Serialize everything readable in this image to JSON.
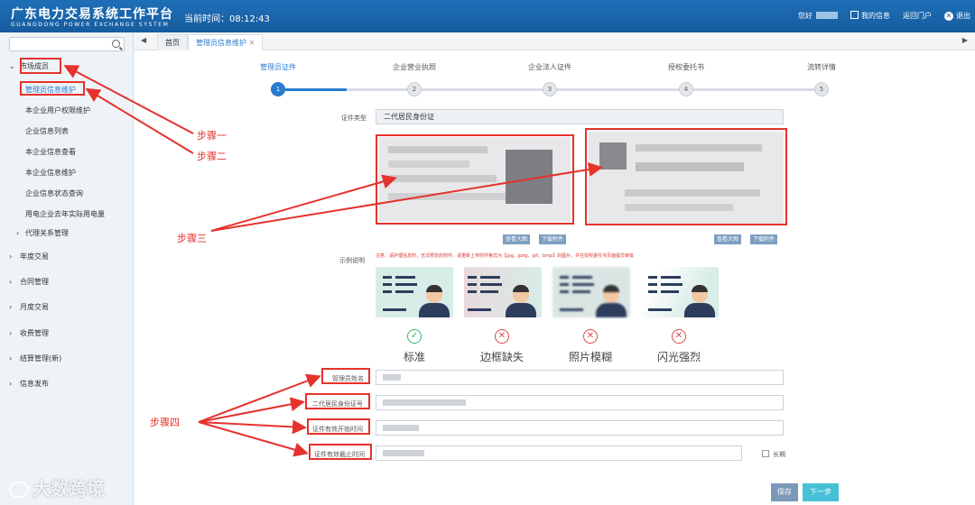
{
  "header": {
    "title": "广东电力交易系统工作平台",
    "subtitle": "GUANGDONG POWER EXCHANGE SYSTEM",
    "time_label": "当前时间：08:12:43",
    "greeting": "您好",
    "my_info": "我的信息",
    "back_portal": "返回门户",
    "logout": "退出"
  },
  "sidebar": {
    "search_placeholder": "",
    "sections": [
      {
        "label": "市场成员",
        "expanded": true
      },
      {
        "label": "年度交易"
      },
      {
        "label": "合同管理"
      },
      {
        "label": "月度交易"
      },
      {
        "label": "收费管理"
      },
      {
        "label": "结算管理(新)"
      },
      {
        "label": "信息发布"
      }
    ],
    "sub_items": [
      "管理员信息维护",
      "本企业用户权限维护",
      "企业信息列表",
      "本企业信息查看",
      "本企业信息维护",
      "企业信息状态查询",
      "用电企业去年实际用电量"
    ],
    "sub_section": "代理关系管理"
  },
  "tabs": {
    "home": "首页",
    "current": "管理员信息维护",
    "close": "✕"
  },
  "steps": [
    {
      "label": "管理员证件",
      "num": "1"
    },
    {
      "label": "企业营业执照",
      "num": "2"
    },
    {
      "label": "企业法人证件",
      "num": "3"
    },
    {
      "label": "授权委托书",
      "num": "4"
    },
    {
      "label": "流转详情",
      "num": "5"
    }
  ],
  "form": {
    "cert_type_label": "证件类型",
    "cert_type_value": "二代居民身份证",
    "view_large": "查看大图",
    "download": "下载附件",
    "example_label": "示例说明",
    "note": "注意：请护理信息时，无法预览的附件，请重新上传附件格式为【jpg、jpeg、gif、bmp】的图片，并在授权委托书页面提交审批",
    "examples": [
      "标准",
      "边框缺失",
      "照片模糊",
      "闪光强烈"
    ],
    "admin_name_label": "管理员姓名",
    "id_number_label": "二代居民身份证号",
    "valid_start_label": "证件有效开始时间",
    "valid_end_label": "证件有效截止时间",
    "long_term": "长期"
  },
  "annotations": {
    "step1": "步骤一",
    "step2": "步骤二",
    "step3": "步骤三",
    "step4": "步骤四"
  },
  "buttons": {
    "save": "保存",
    "next": "下一步"
  },
  "watermark": "大数跨境",
  "colors": {
    "header_blue": "#1a64a8",
    "accent_blue": "#2a7bd0",
    "annotation_red": "#e5322c",
    "ok_green": "#39b36e",
    "save_btn": "#7a98b8",
    "next_btn": "#46c0d6"
  }
}
